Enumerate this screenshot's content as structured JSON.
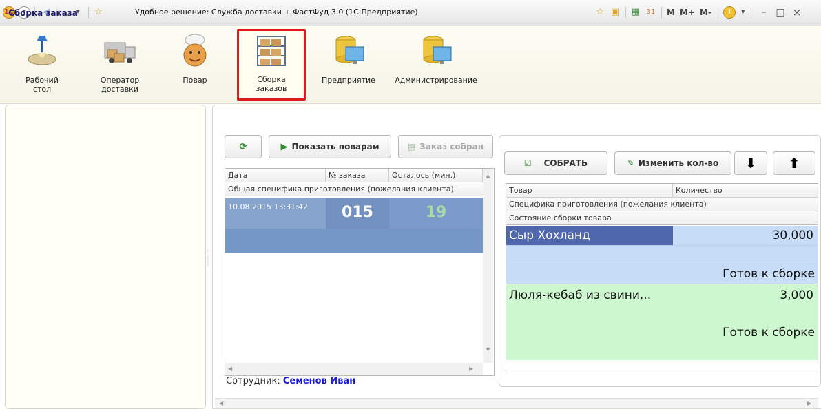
{
  "window": {
    "title": "Удобное решение: Служба доставки + ФастФуд 3.0  (1С:Предприятие)",
    "toolbar_right": [
      "M",
      "M+",
      "M-"
    ],
    "controls": [
      "–",
      "□",
      "×"
    ]
  },
  "sections": [
    {
      "label_line1": "Рабочий",
      "label_line2": "стол",
      "icon": "desk-lamp-icon"
    },
    {
      "label_line1": "Оператор",
      "label_line2": "доставки",
      "icon": "delivery-truck-icon"
    },
    {
      "label_line1": "Повар",
      "label_line2": "",
      "icon": "chef-icon"
    },
    {
      "label_line1": "Сборка",
      "label_line2": "заказов",
      "icon": "shelves-icon"
    },
    {
      "label_line1": "Предприятие",
      "label_line2": "",
      "icon": "database-monitor-icon"
    },
    {
      "label_line1": "Администрирование",
      "label_line2": "",
      "icon": "database-monitor-icon"
    }
  ],
  "left_panel": {
    "title": "Сборка заказа"
  },
  "orders_toolbar": {
    "refresh_icon": "refresh-icon",
    "show_to_cooks": "Показать поварам",
    "order_assembled": "Заказ собран"
  },
  "orders_table": {
    "columns": [
      "Дата",
      "№ заказа",
      "Осталось (мин.)"
    ],
    "subheader": "Общая специфика приготовления (пожелания клиента)",
    "rows": [
      {
        "date": "10.08.2015 13:31:42",
        "number": "015",
        "remaining": "19"
      }
    ]
  },
  "employee": {
    "label": "Сотрудник:",
    "name": "Семенов Иван"
  },
  "items_toolbar": {
    "collect": "СОБРАТЬ",
    "change_qty": "Изменить кол-во"
  },
  "items_table": {
    "columns": [
      "Товар",
      "Количество"
    ],
    "subheader1": "Специфика приготовления (пожелания клиента)",
    "subheader2": "Состояние сборки товара",
    "rows": [
      {
        "name": "Сыр  Хохланд",
        "qty": "30,000",
        "status": "Готов к сборке"
      },
      {
        "name": "Люля-кебаб из свини...",
        "qty": "3,000",
        "status": "Готов к сборке"
      }
    ]
  },
  "colors": {
    "selected_row": "#7f9dc9",
    "item1_name": "#4f67ad",
    "item1_bg": "#c6dcf7",
    "item2_bg": "#ccf7cf",
    "employee_name": "#1b1bd6",
    "highlight_border": "#e01b1b"
  }
}
